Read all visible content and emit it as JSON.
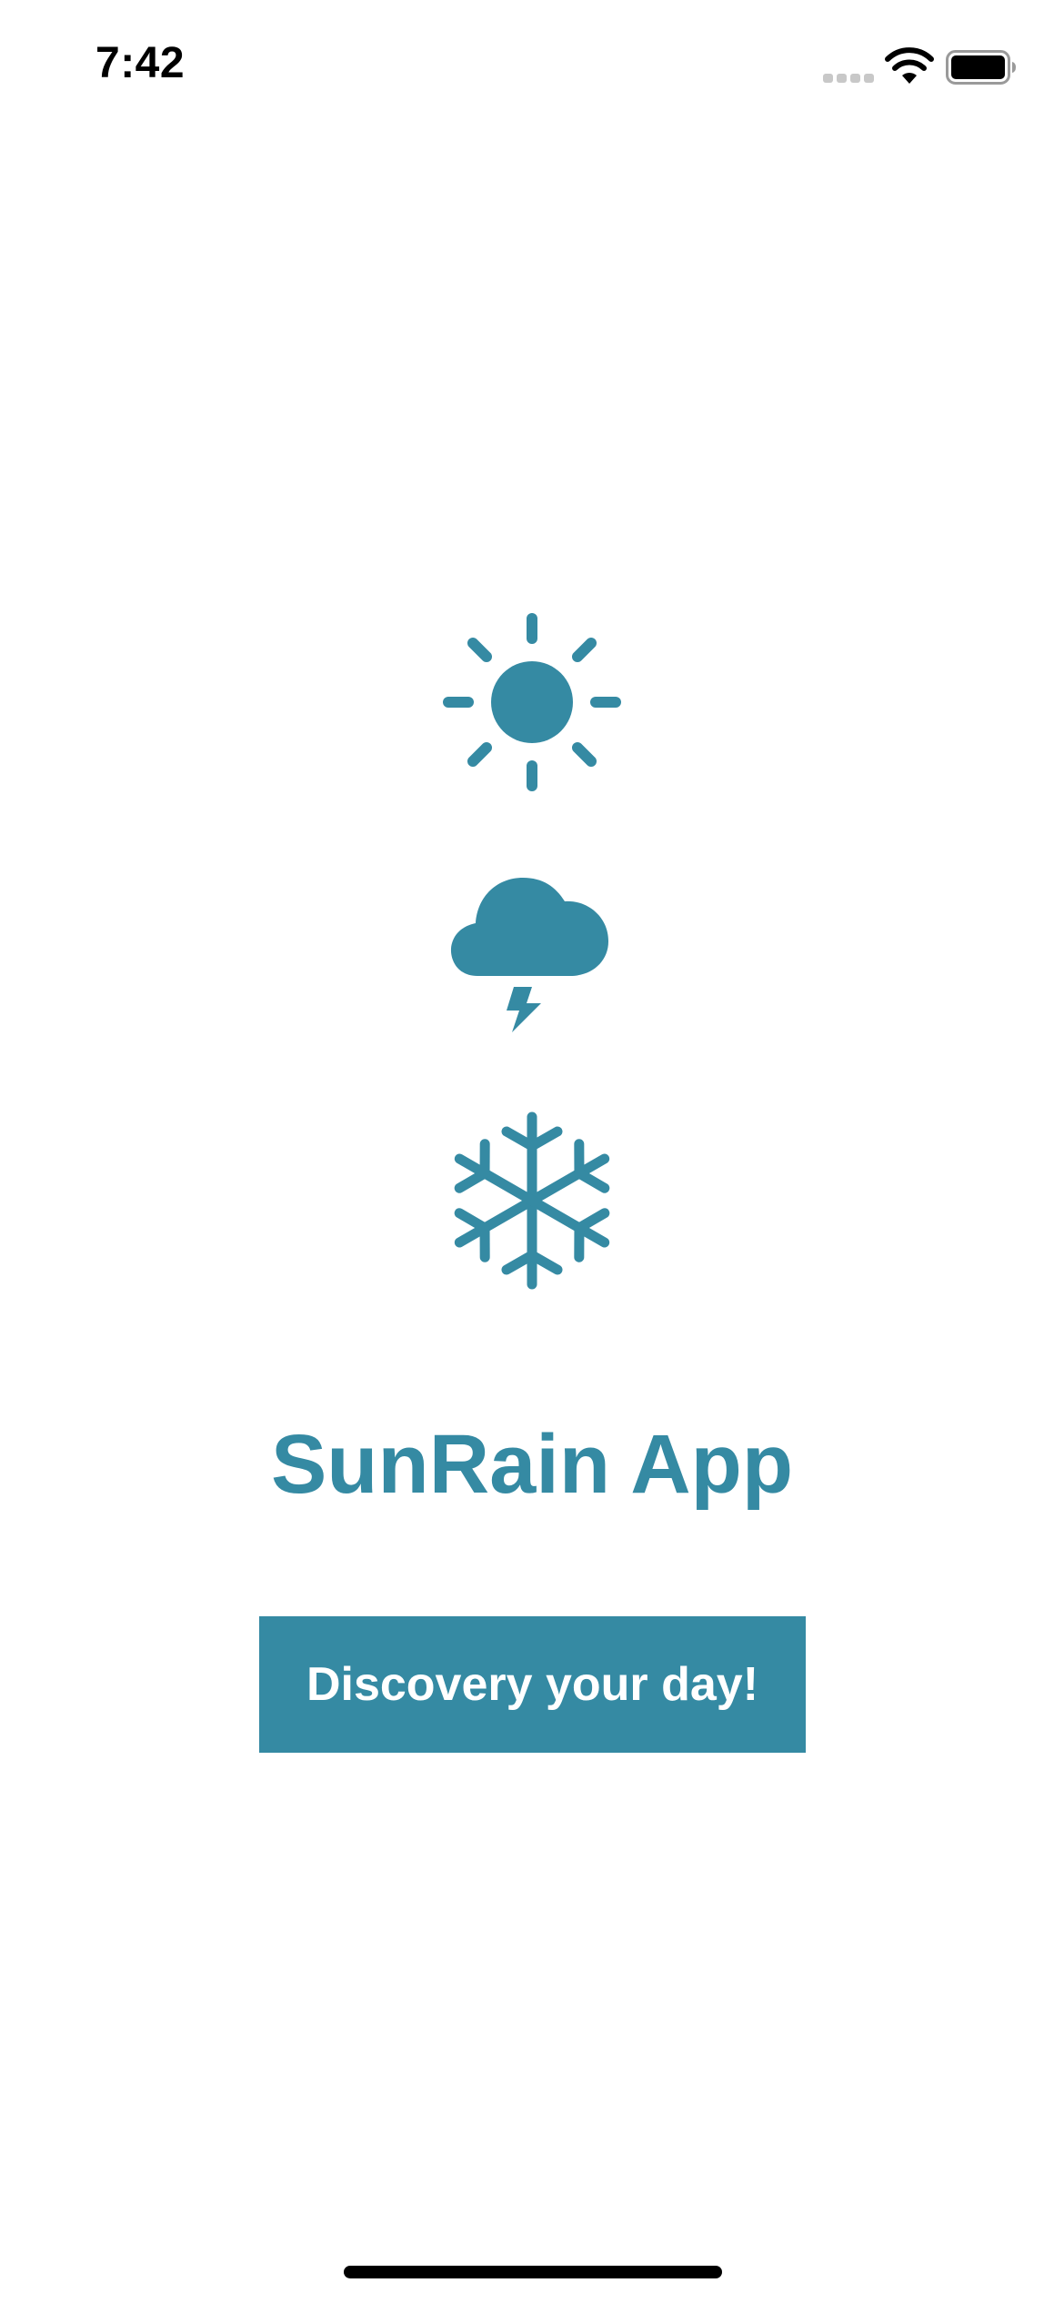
{
  "status_bar": {
    "time": "7:42",
    "signal_icon": "cellular-signal-icon",
    "wifi_icon": "wifi-icon",
    "battery_icon": "battery-icon"
  },
  "icons": {
    "sun": "sun-icon",
    "storm": "thunderstorm-cloud-icon",
    "snow": "snowflake-icon"
  },
  "app": {
    "title": "SunRain App",
    "button_label": "Discovery your day!"
  },
  "colors": {
    "accent": "#358aa3",
    "background": "#ffffff",
    "button_text": "#ffffff"
  }
}
